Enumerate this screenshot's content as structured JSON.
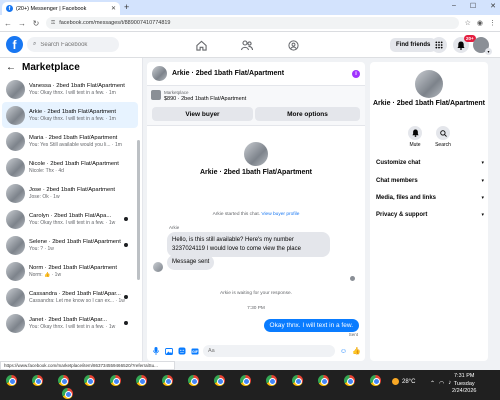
{
  "browser": {
    "tab_title": "(20+) Messenger | Facebook",
    "url": "facebook.com/messages/t/889007410774819",
    "status_url": "https://www.facebook.com/marketplace/item/863734559466520/?referralSu..."
  },
  "fbnav": {
    "search_placeholder": "Search Facebook",
    "find_friends": "Find friends",
    "notifications_badge": "20+"
  },
  "sidebar": {
    "title": "Marketplace",
    "conversations": [
      {
        "name": "Vanessa · 2bed 1bath Flat/Apartment",
        "preview": "You: Okay thnx. I will text in a few. · 1m",
        "active": false,
        "dot": false
      },
      {
        "name": "Arkie · 2bed 1bath Flat/Apartment",
        "preview": "You: Okay thnx. I will text in a few. · 1m",
        "active": true,
        "dot": false
      },
      {
        "name": "Maria · 2bed 1bath Flat/Apartment",
        "preview": "You: Yes Still available would you li... · 1m",
        "active": false,
        "dot": false
      },
      {
        "name": "Nicole · 2bed 1bath Flat/Apartment",
        "preview": "Nicole: Thx · 4d",
        "active": false,
        "dot": false
      },
      {
        "name": "Jose · 2bed 1bath Flat/Apartment",
        "preview": "Jose: Ok · 1w",
        "active": false,
        "dot": false
      },
      {
        "name": "Carolyn · 2bed 1bath Flat/Apa...",
        "preview": "You: Okay thnx. I will text in a few. · 1w",
        "active": false,
        "dot": true
      },
      {
        "name": "Selene · 2bed 1bath Flat/Apartment",
        "preview": "You: ? · 1w",
        "active": false,
        "dot": true
      },
      {
        "name": "Norm · 2bed 1bath Flat/Apartment",
        "preview": "Norm: 👍 · 1w",
        "active": false,
        "dot": false
      },
      {
        "name": "Cassandra · 2bed 1bath Flat/Apar...",
        "preview": "Cassandra: Let me know so I can ex... · 1w",
        "active": false,
        "dot": true
      },
      {
        "name": "Janet · 2bed 1bath Flat/Apar...",
        "preview": "You: Okay thnx. I will text in a few. · 1w",
        "active": false,
        "dot": true
      }
    ]
  },
  "chat": {
    "title": "Arkie · 2bed 1bath Flat/Apartment",
    "listing_label": "Marketplace",
    "listing_price_title": "$890 · 2bed 1bath Flat/Apartment",
    "btn_view_buyer": "View buyer",
    "btn_more_options": "More options",
    "intro_title": "Arkie · 2bed 1bath Flat/Apartment",
    "started_note": "Arkie started this chat.",
    "started_link": "View buyer profile",
    "sender_label": "Arkie",
    "message_1": "Hello, is this still available? Here's my number 3237024119 I would love to come view the place",
    "message_2": "Message sent",
    "waiting_note": "Arkie is waiting for your response.",
    "time_note": "7:30 PM",
    "outgoing_message": "Okay thnx. I will text in a few.",
    "sent_label": "Sent",
    "composer_placeholder": "Aa"
  },
  "right_panel": {
    "title": "Arkie · 2bed 1bath Flat/Apartment",
    "mute_label": "Mute",
    "search_label": "Search",
    "sections": [
      "Customize chat",
      "Chat members",
      "Media, files and links",
      "Privacy & support"
    ]
  },
  "taskbar": {
    "weather": "28°C",
    "time": "7:31 PM",
    "day": "Tuesday",
    "date": "2/24/2026"
  }
}
